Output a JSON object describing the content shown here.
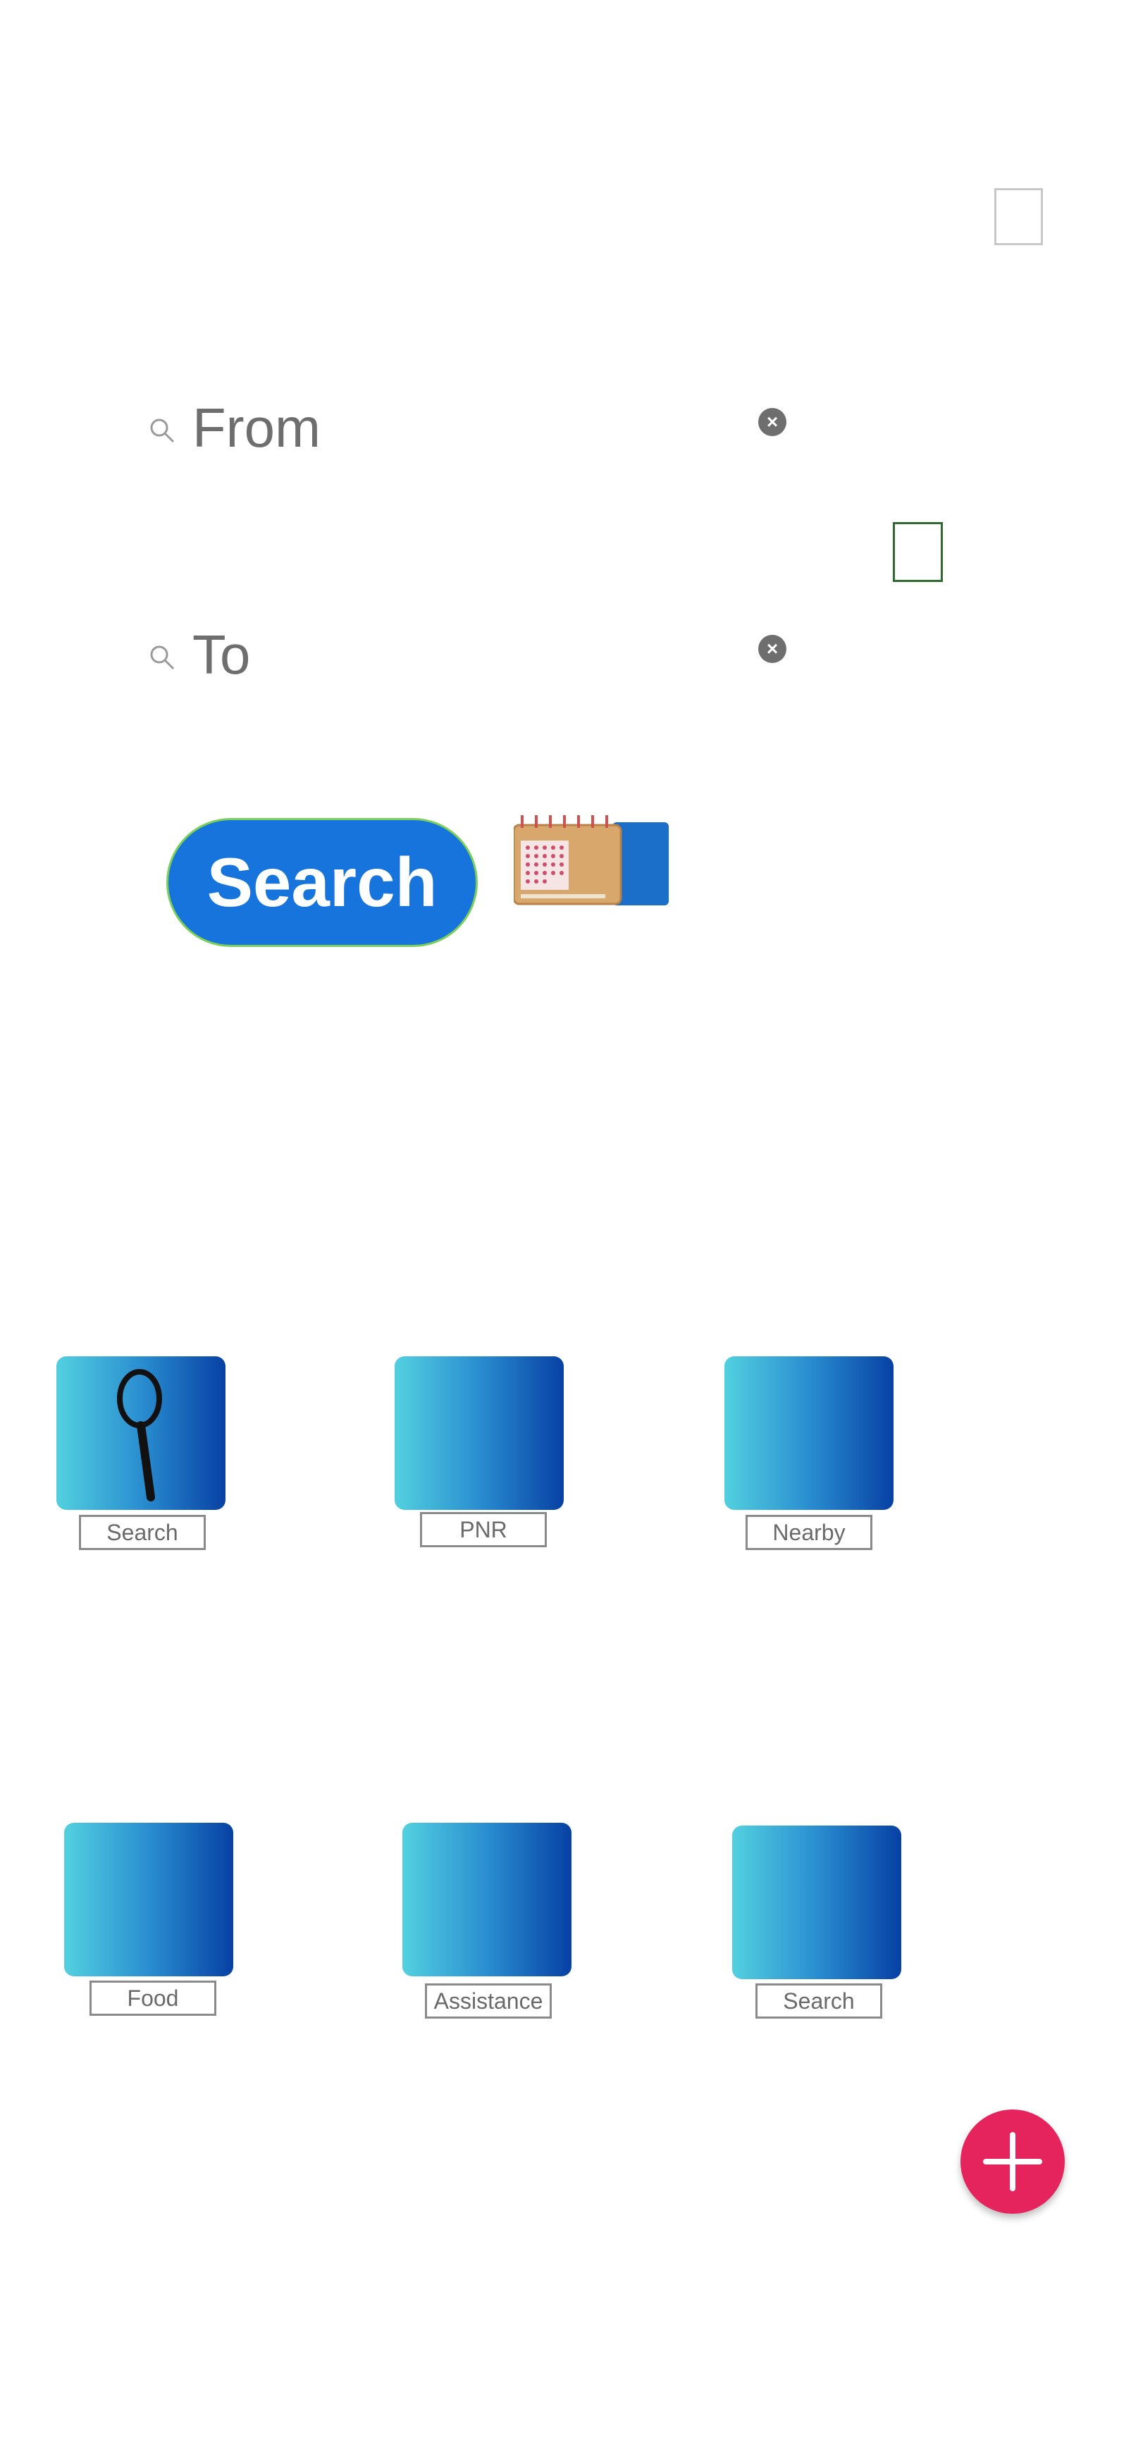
{
  "form": {
    "from_placeholder": "From",
    "to_placeholder": "To",
    "search_button_label": "Search"
  },
  "tiles": [
    {
      "label": "Search"
    },
    {
      "label": "PNR"
    },
    {
      "label": "Nearby"
    },
    {
      "label": "Food"
    },
    {
      "label": "Assistance"
    },
    {
      "label": "Search"
    }
  ],
  "icons": {
    "from_field": "search-icon",
    "to_field": "search-icon",
    "clear": "clear-icon",
    "calendar": "calendar-icon",
    "tile_search": "magnifier-icon",
    "fab": "plus-icon"
  },
  "colors": {
    "primary_button": "#1674dc",
    "fab": "#e5245e",
    "tile_gradient_start": "#52d0df",
    "tile_gradient_end": "#0741a4"
  }
}
